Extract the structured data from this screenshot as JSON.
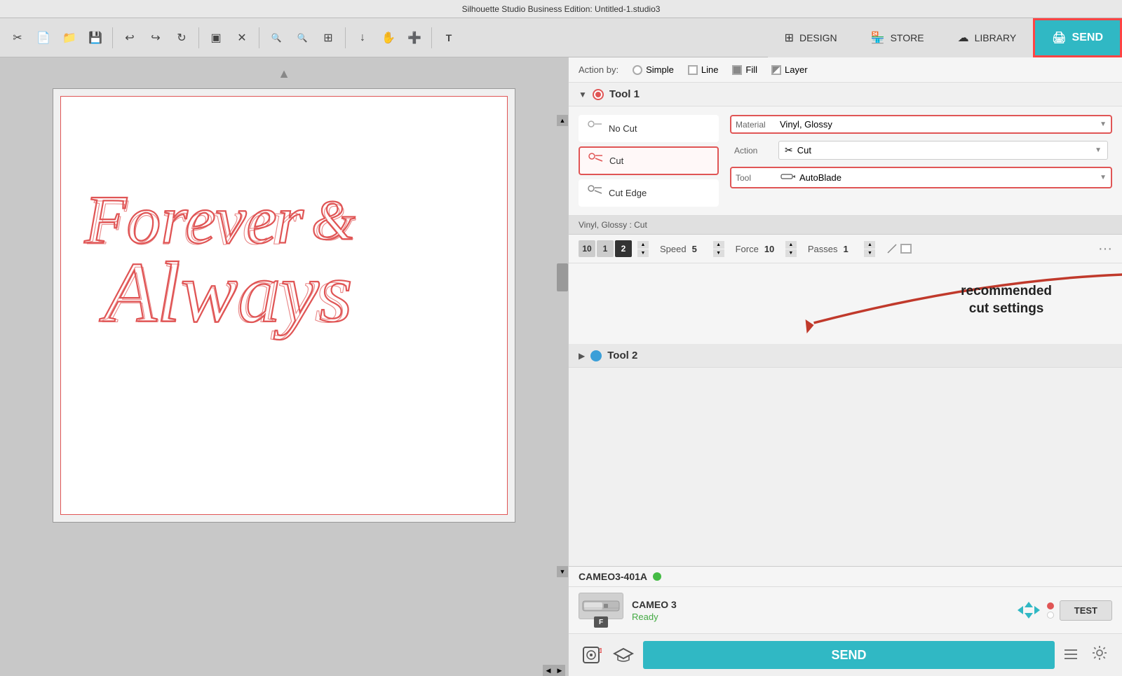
{
  "titlebar": {
    "title": "Silhouette Studio Business Edition: Untitled-1.studio3"
  },
  "toolbar": {
    "tools": [
      {
        "name": "cut-icon",
        "symbol": "✂",
        "label": "Cut"
      },
      {
        "name": "new-icon",
        "symbol": "📄",
        "label": "New"
      },
      {
        "name": "open-icon",
        "symbol": "📁",
        "label": "Open"
      },
      {
        "name": "save-icon",
        "symbol": "💾",
        "label": "Save"
      },
      {
        "name": "undo-icon",
        "symbol": "↩",
        "label": "Undo"
      },
      {
        "name": "redo-icon",
        "symbol": "↪",
        "label": "Redo"
      },
      {
        "name": "refresh-icon",
        "symbol": "↻",
        "label": "Refresh"
      },
      {
        "name": "select-icon",
        "symbol": "▣",
        "label": "Select"
      },
      {
        "name": "delete-icon",
        "symbol": "✕",
        "label": "Delete"
      },
      {
        "name": "zoom-in-icon",
        "symbol": "🔍+",
        "label": "Zoom In"
      },
      {
        "name": "zoom-out-icon",
        "symbol": "🔍-",
        "label": "Zoom Out"
      },
      {
        "name": "zoom-fit-icon",
        "symbol": "⊞",
        "label": "Zoom Fit"
      },
      {
        "name": "move-down-icon",
        "symbol": "↓",
        "label": "Move Down"
      },
      {
        "name": "pan-icon",
        "symbol": "✋",
        "label": "Pan"
      },
      {
        "name": "add-page-icon",
        "symbol": "➕",
        "label": "Add Page"
      },
      {
        "name": "text-icon",
        "symbol": "T",
        "label": "Text"
      }
    ]
  },
  "navbar": {
    "design_label": "DESIGN",
    "store_label": "STORE",
    "library_label": "LIBRARY",
    "send_label": "SEND"
  },
  "right_panel": {
    "action_by_label": "Action by:",
    "simple_label": "Simple",
    "line_label": "Line",
    "fill_label": "Fill",
    "layer_label": "Layer",
    "tool1_label": "Tool 1",
    "tool2_label": "Tool 2",
    "no_cut_label": "No Cut",
    "cut_label": "Cut",
    "cut_edge_label": "Cut Edge",
    "material_label": "Material",
    "material_value": "Vinyl, Glossy",
    "action_label": "Action",
    "action_value": "Cut",
    "tool_label": "Tool",
    "tool_value": "AutoBlade",
    "cut_settings_label": "Vinyl, Glossy : Cut",
    "speed_label": "Speed",
    "speed_value": "5",
    "force_label": "Force",
    "force_value": "10",
    "passes_label": "Passes",
    "passes_value": "1",
    "annotation_text": "recommended\ncut settings",
    "num_boxes": [
      "10",
      "1",
      "2"
    ],
    "num_active": 2
  },
  "device": {
    "name": "CAMEO3-401A",
    "model": "CAMEO 3",
    "status": "Ready",
    "test_label": "TEST",
    "send_label": "SEND"
  }
}
